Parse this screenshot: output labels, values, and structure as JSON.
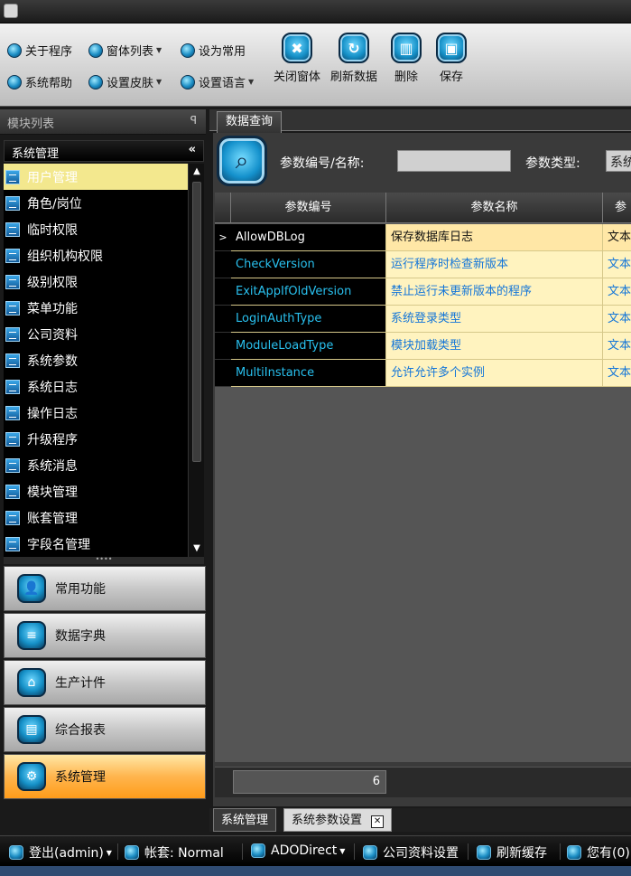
{
  "ribbon": {
    "row1": [
      {
        "label": "关于程序",
        "icon": "info-icon"
      },
      {
        "label": "窗体列表",
        "icon": "window-list-icon",
        "dropdown": true
      },
      {
        "label": "设为常用",
        "icon": "favorite-icon"
      }
    ],
    "row2": [
      {
        "label": "系统帮助",
        "icon": "help-icon"
      },
      {
        "label": "设置皮肤",
        "icon": "skin-icon",
        "dropdown": true
      },
      {
        "label": "设置语言",
        "icon": "language-icon",
        "dropdown": true
      }
    ],
    "big_buttons": [
      {
        "label": "关闭窗体",
        "icon": "close-window-icon",
        "glyph": "✖"
      },
      {
        "label": "刷新数据",
        "icon": "refresh-icon",
        "glyph": "↻"
      },
      {
        "label": "删除",
        "icon": "trash-icon",
        "glyph": "▥"
      },
      {
        "label": "保存",
        "icon": "save-icon",
        "glyph": "▣"
      }
    ]
  },
  "left_panel": {
    "title": "模块列表",
    "pin": "ꟼ",
    "group": "系统管理",
    "collapse": "«",
    "items": [
      "用户管理",
      "角色/岗位",
      "临时权限",
      "组织机构权限",
      "级别权限",
      "菜单功能",
      "公司资料",
      "系统参数",
      "系统日志",
      "操作日志",
      "升级程序",
      "系统消息",
      "模块管理",
      "账套管理",
      "字段名管理"
    ],
    "nav": [
      {
        "label": "常用功能",
        "icon": "user-icon",
        "glyph": "👤"
      },
      {
        "label": "数据字典",
        "icon": "database-icon",
        "glyph": "≡"
      },
      {
        "label": "生产计件",
        "icon": "home-icon",
        "glyph": "⌂"
      },
      {
        "label": "综合报表",
        "icon": "report-icon",
        "glyph": "▤"
      },
      {
        "label": "系统管理",
        "icon": "gear-icon",
        "glyph": "⚙",
        "active": true
      }
    ]
  },
  "main": {
    "tab": "数据查询",
    "search": {
      "code_label": "参数编号/名称:",
      "code_value": "",
      "type_label": "参数类型:",
      "type_value": "系统"
    },
    "grid": {
      "headers": [
        "参数编号",
        "参数名称",
        "参"
      ],
      "rows": [
        {
          "code": "AllowDBLog",
          "name": "保存数据库日志",
          "type": "文本"
        },
        {
          "code": "CheckVersion",
          "name": "运行程序时检查新版本",
          "type": "文本"
        },
        {
          "code": "ExitAppIfOldVersion",
          "name": "禁止运行未更新版本的程序",
          "type": "文本"
        },
        {
          "code": "LoginAuthType",
          "name": "系统登录类型",
          "type": "文本"
        },
        {
          "code": "ModuleLoadType",
          "name": "模块加载类型",
          "type": "文本"
        },
        {
          "code": "MultiInstance",
          "name": "允许允许多个实例",
          "type": "文本"
        }
      ],
      "current_row_marker": ">",
      "count": "6"
    },
    "bottom_tabs": [
      "系统管理",
      "系统参数设置"
    ],
    "close_glyph": "✕"
  },
  "statusbar": [
    {
      "label": "登出(admin)",
      "dropdown": true,
      "icon": "logout-icon"
    },
    {
      "label": "帐套: Normal",
      "icon": "account-icon"
    },
    {
      "label": "ADODirect",
      "dropdown": true,
      "icon": "connection-icon"
    },
    {
      "label": "公司资料设置",
      "icon": "gear-icon"
    },
    {
      "label": "刷新缓存",
      "icon": "refresh-cache-icon"
    },
    {
      "label": "您有(0)",
      "icon": "message-icon"
    }
  ],
  "colors": {
    "selected_row": "#ffe7a6",
    "grid_cell": "#fff3bf",
    "active_nav": "#ffb54d",
    "accent_blue": "#1590c7"
  }
}
